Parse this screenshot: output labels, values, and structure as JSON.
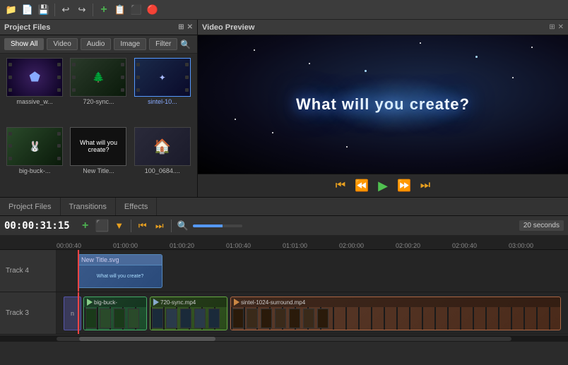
{
  "toolbar": {
    "icons": [
      "📁",
      "📄",
      "💾",
      "↩",
      "↪",
      "➕",
      "📋",
      "⬛",
      "🔴"
    ]
  },
  "leftPanel": {
    "title": "Project Files",
    "headerIcons": [
      "⊞",
      "✕"
    ],
    "filterButtons": [
      "Show All",
      "Video",
      "Audio",
      "Image",
      "Filter"
    ],
    "files": [
      {
        "label": "massive_w...",
        "type": "video"
      },
      {
        "label": "720-sync...",
        "type": "video"
      },
      {
        "label": "sintel-10...",
        "type": "video",
        "active": true
      },
      {
        "label": "big-buck-...",
        "type": "video"
      },
      {
        "label": "New Title...",
        "type": "title"
      },
      {
        "label": "100_0684....",
        "type": "image"
      }
    ]
  },
  "rightPanel": {
    "title": "Video Preview",
    "headerIcons": [
      "⊞",
      "✕"
    ],
    "previewText": "What will you create?",
    "controls": [
      "⏮",
      "⏪",
      "▶",
      "⏩",
      "⏭"
    ]
  },
  "tabs": [
    {
      "label": "Project Files",
      "active": false
    },
    {
      "label": "Transitions",
      "active": false
    },
    {
      "label": "Effects",
      "active": false
    }
  ],
  "timeline": {
    "timeDisplay": "00:00:31:15",
    "secondsLabel": "20 seconds",
    "rulerMarks": [
      "00:00:40",
      "01:00:00",
      "01:00:20",
      "01:00:40",
      "01:01:00",
      "02:00:00",
      "02:00:20",
      "02:00:40",
      "03:00:00"
    ],
    "tracks": [
      {
        "label": "Track 4",
        "clips": [
          {
            "type": "title",
            "name": "New Title.svg"
          }
        ]
      },
      {
        "label": "Track 3",
        "clips": [
          {
            "type": "n"
          },
          {
            "type": "bigbuck",
            "name": "big-buck-"
          },
          {
            "type": "sync",
            "name": "720-sync.mp4"
          },
          {
            "type": "sintel",
            "name": "sintel-1024-surround.mp4"
          }
        ]
      }
    ]
  }
}
